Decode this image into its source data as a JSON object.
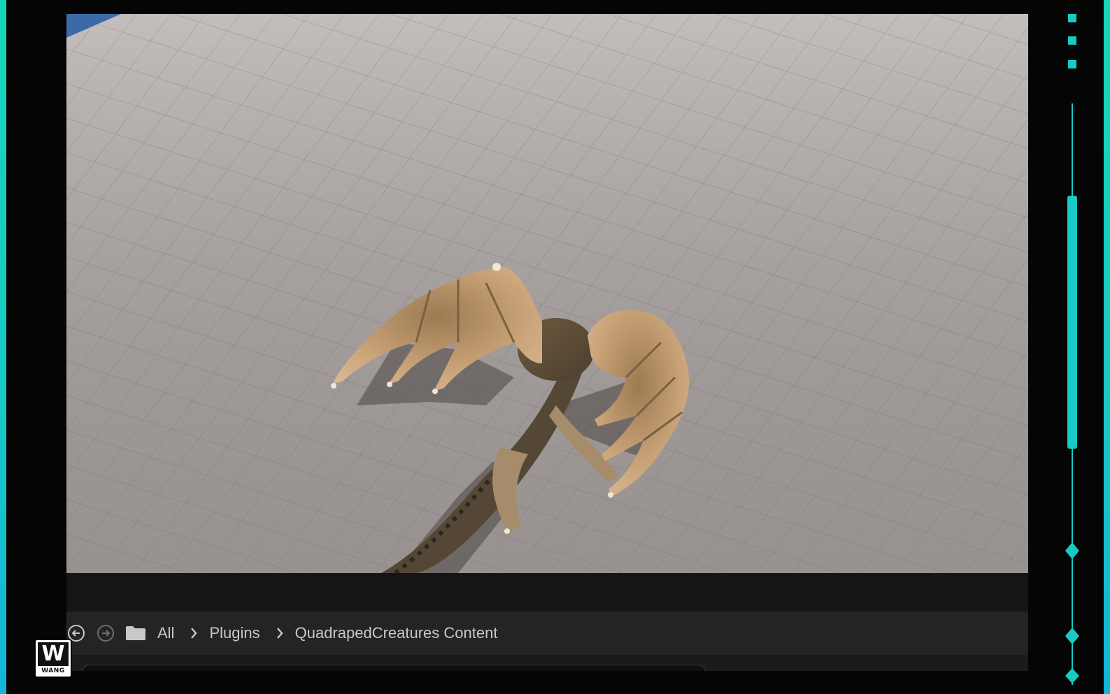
{
  "colors": {
    "accent_teal": "#18c9c4",
    "panel_bg": "#242424",
    "viewport_floor": "#aaa4a2",
    "sky_blue": "#3c6aa8"
  },
  "viewport": {
    "subject": "winged-creature-model"
  },
  "content_browser": {
    "back_icon": "arrow-left-circle-icon",
    "forward_icon": "arrow-right-circle-icon",
    "folder_icon": "folder-icon",
    "breadcrumbs": [
      "All",
      "Plugins",
      "QuadrapedCreatures Content"
    ]
  },
  "logo": {
    "mark": "W",
    "text": "WANG"
  }
}
